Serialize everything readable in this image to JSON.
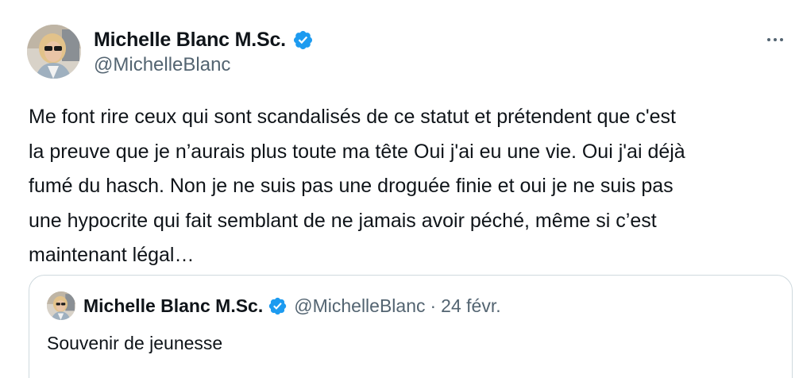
{
  "author": {
    "display_name": "Michelle Blanc M.Sc.",
    "handle": "@MichelleBlanc",
    "verified": true,
    "avatar_icon": "profile-photo"
  },
  "tweet": {
    "text": "Me font rire ceux qui sont scandalisés de ce statut et prétendent que c'est\nla preuve que je n’aurais plus toute ma tête Oui j'ai eu une vie. Oui j'ai déjà\nfumé du hasch. Non je ne suis pas une droguée finie et oui je ne suis pas\nune hypocrite qui fait semblant de ne jamais avoir péché, même si c’est\nmaintenant légal…"
  },
  "more_menu": {
    "icon": "more-horizontal-icon"
  },
  "quote": {
    "display_name": "Michelle Blanc M.Sc.",
    "handle": "@MichelleBlanc",
    "separator": "·",
    "date": "24 févr.",
    "text": "Souvenir de jeunesse"
  },
  "colors": {
    "verified_blue": "#1d9bf0",
    "secondary_text": "#536471",
    "primary_text": "#0f1419",
    "border": "#cfd9de"
  }
}
